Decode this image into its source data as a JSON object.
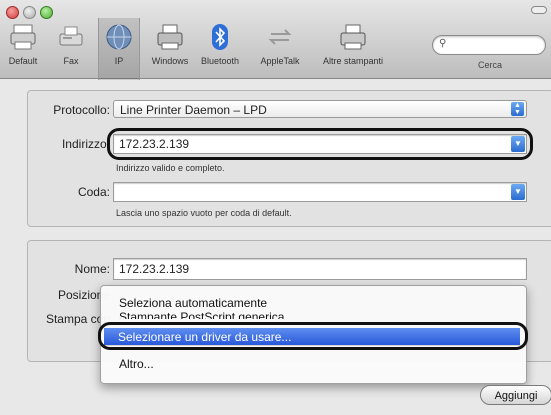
{
  "toolbar": {
    "items": [
      {
        "label": "Default",
        "icon": "default-printer-icon"
      },
      {
        "label": "Fax",
        "icon": "fax-icon"
      },
      {
        "label": "IP",
        "icon": "ip-globe-icon"
      },
      {
        "label": "Windows",
        "icon": "windows-printer-icon"
      },
      {
        "label": "Bluetooth",
        "icon": "bluetooth-icon"
      },
      {
        "label": "AppleTalk",
        "icon": "appletalk-icon"
      },
      {
        "label": "Altre stampanti",
        "icon": "other-printers-icon"
      }
    ],
    "search_label": "Cerca"
  },
  "form": {
    "protocol_label": "Protocollo:",
    "protocol_value": "Line Printer Daemon – LPD",
    "address_label": "Indirizzo:",
    "address_value": "172.23.2.139",
    "address_hint": "Indirizzo valido e completo.",
    "queue_label": "Coda:",
    "queue_value": "",
    "queue_hint": "Lascia uno spazio vuoto per coda di default.",
    "name_label": "Nome:",
    "name_value": "172.23.2.139",
    "location_label": "Posizione",
    "print_using_label": "Stampa con"
  },
  "menu": {
    "items": [
      "Seleziona automaticamente",
      "Stampante PostScript generica",
      "Selezionare un driver da usare...",
      "Altro..."
    ],
    "highlighted_index": 2
  },
  "buttons": {
    "add": "Aggiungi"
  },
  "colors": {
    "highlight": "#2f62dc",
    "annotation_oval": "#111111"
  }
}
